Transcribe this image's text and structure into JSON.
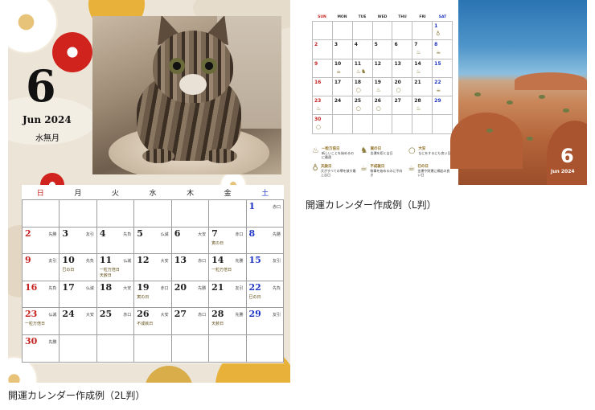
{
  "calendar_2l": {
    "month_number": "6",
    "month_en": "Jun 2024",
    "month_jp": "水無月",
    "weekdays": [
      "日",
      "月",
      "火",
      "水",
      "木",
      "金",
      "土"
    ],
    "weekday_colors": [
      "#c5221f",
      "#222222",
      "#222222",
      "#222222",
      "#222222",
      "#222222",
      "#1f36c5"
    ],
    "weeks": [
      [
        null,
        null,
        null,
        null,
        null,
        null,
        {
          "d": "1",
          "r": "赤口"
        }
      ],
      [
        {
          "d": "2",
          "r": "先勝"
        },
        {
          "d": "3",
          "r": "友引"
        },
        {
          "d": "4",
          "r": "先負"
        },
        {
          "d": "5",
          "r": "仏滅"
        },
        {
          "d": "6",
          "r": "大安"
        },
        {
          "d": "7",
          "r": "赤口",
          "l": [
            "寅の日"
          ]
        },
        {
          "d": "8",
          "r": "先勝"
        }
      ],
      [
        {
          "d": "9",
          "r": "友引"
        },
        {
          "d": "10",
          "r": "先負",
          "l": [
            "巳の日"
          ]
        },
        {
          "d": "11",
          "r": "仏滅",
          "l": [
            "一粒万倍日",
            "天赦日"
          ]
        },
        {
          "d": "12",
          "r": "大安"
        },
        {
          "d": "13",
          "r": "赤口"
        },
        {
          "d": "14",
          "r": "先勝",
          "l": [
            "一粒万倍日"
          ]
        },
        {
          "d": "15",
          "r": "友引"
        }
      ],
      [
        {
          "d": "16",
          "r": "先負"
        },
        {
          "d": "17",
          "r": "仏滅"
        },
        {
          "d": "18",
          "r": "大安"
        },
        {
          "d": "19",
          "r": "赤口",
          "l": [
            "寅の日"
          ]
        },
        {
          "d": "20",
          "r": "先勝"
        },
        {
          "d": "21",
          "r": "友引"
        },
        {
          "d": "22",
          "r": "先負",
          "l": [
            "巳の日"
          ]
        }
      ],
      [
        {
          "d": "23",
          "r": "仏滅",
          "l": [
            "一粒万倍日"
          ]
        },
        {
          "d": "24",
          "r": "大安"
        },
        {
          "d": "25",
          "r": "赤口"
        },
        {
          "d": "26",
          "r": "大安",
          "l": [
            "不成就日"
          ]
        },
        {
          "d": "27",
          "r": "赤口"
        },
        {
          "d": "28",
          "r": "先勝",
          "l": [
            "天赦日"
          ]
        },
        {
          "d": "29",
          "r": "友引"
        }
      ],
      [
        {
          "d": "30",
          "r": "先勝"
        },
        null,
        null,
        null,
        null,
        null,
        null
      ]
    ],
    "caption": "開運カレンダー作成例（2L判）"
  },
  "calendar_l": {
    "month_number": "6",
    "month_en": "Jun 2024",
    "weekdays": [
      "SUN",
      "MON",
      "TUE",
      "WED",
      "THU",
      "FRI",
      "SAT"
    ],
    "weekday_colors": [
      "#c5221f",
      "#333333",
      "#333333",
      "#333333",
      "#333333",
      "#333333",
      "#1f36c5"
    ],
    "weeks": [
      [
        null,
        null,
        null,
        null,
        null,
        null,
        {
          "d": "1",
          "m": "♁"
        }
      ],
      [
        {
          "d": "2"
        },
        {
          "d": "3"
        },
        {
          "d": "4"
        },
        {
          "d": "5"
        },
        {
          "d": "6"
        },
        {
          "d": "7",
          "m": "♨"
        },
        {
          "d": "8",
          "m": "☕"
        }
      ],
      [
        {
          "d": "9"
        },
        {
          "d": "10",
          "m": "☕"
        },
        {
          "d": "11",
          "m": "♨♞"
        },
        {
          "d": "12"
        },
        {
          "d": "13"
        },
        {
          "d": "14",
          "m": "♨"
        },
        {
          "d": "15"
        }
      ],
      [
        {
          "d": "16"
        },
        {
          "d": "17"
        },
        {
          "d": "18",
          "m": "○"
        },
        {
          "d": "19",
          "m": "♨"
        },
        {
          "d": "20",
          "m": "○"
        },
        {
          "d": "21"
        },
        {
          "d": "22",
          "m": "☕"
        }
      ],
      [
        {
          "d": "23",
          "m": "♨"
        },
        {
          "d": "24"
        },
        {
          "d": "25",
          "m": "○"
        },
        {
          "d": "26",
          "m": "○"
        },
        {
          "d": "27"
        },
        {
          "d": "28",
          "m": "♨"
        },
        {
          "d": "29"
        }
      ],
      [
        {
          "d": "30",
          "m": "○"
        },
        null,
        null,
        null,
        null,
        null,
        null
      ]
    ],
    "legend": [
      {
        "icon": "♨",
        "title": "一粒万倍日",
        "text": "新しいことを始めるのに最適"
      },
      {
        "icon": "♞",
        "title": "寅の日",
        "text": "金運を招く吉日"
      },
      {
        "icon": "○",
        "title": "大安",
        "text": "なにをするにも良い日"
      },
      {
        "icon": "♁",
        "title": "天赦日",
        "text": "天がすべての罪を赦す最上吉日"
      },
      {
        "icon": "☕",
        "title": "不成就日",
        "text": "物事を始めるのに不向き"
      },
      {
        "icon": "☕",
        "title": "巳の日",
        "text": "金運や財運に縁起の良い日"
      }
    ],
    "caption": "開運カレンダー作成例（L判）"
  }
}
